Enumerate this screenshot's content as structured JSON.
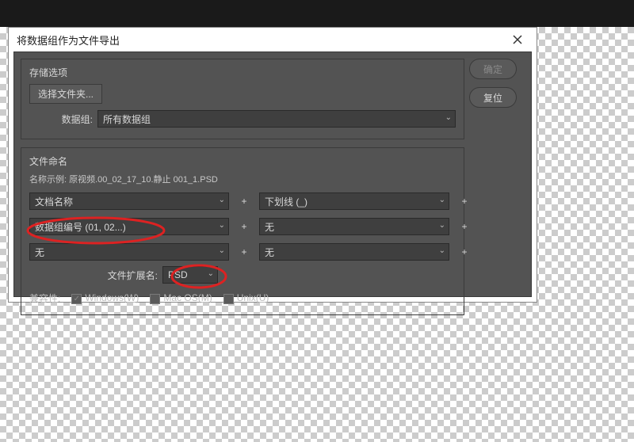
{
  "dialog": {
    "title": "将数据组作为文件导出"
  },
  "storage": {
    "legend": "存储选项",
    "folder_btn": "选择文件夹...",
    "data_group_label": "数据组:",
    "data_group_value": "所有数据组"
  },
  "naming": {
    "legend": "文件命名",
    "example_prefix": "名称示例:",
    "example_value": "原视频.00_02_17_10.静止 001_1.PSD",
    "row1_left": "文档名称",
    "row1_right": "下划线 (_)",
    "row2_left": "数据组编号 (01, 02...)",
    "row2_right": "无",
    "row3_left": "无",
    "row3_right": "无",
    "plus": "+",
    "ext_label": "文件扩展名:",
    "ext_value": "PSD"
  },
  "compat": {
    "label": "兼容性:",
    "windows": "Windows(W)",
    "mac": "Mac OS(M)",
    "unix": "Unix(U)"
  },
  "buttons": {
    "ok": "确定",
    "reset": "复位"
  }
}
